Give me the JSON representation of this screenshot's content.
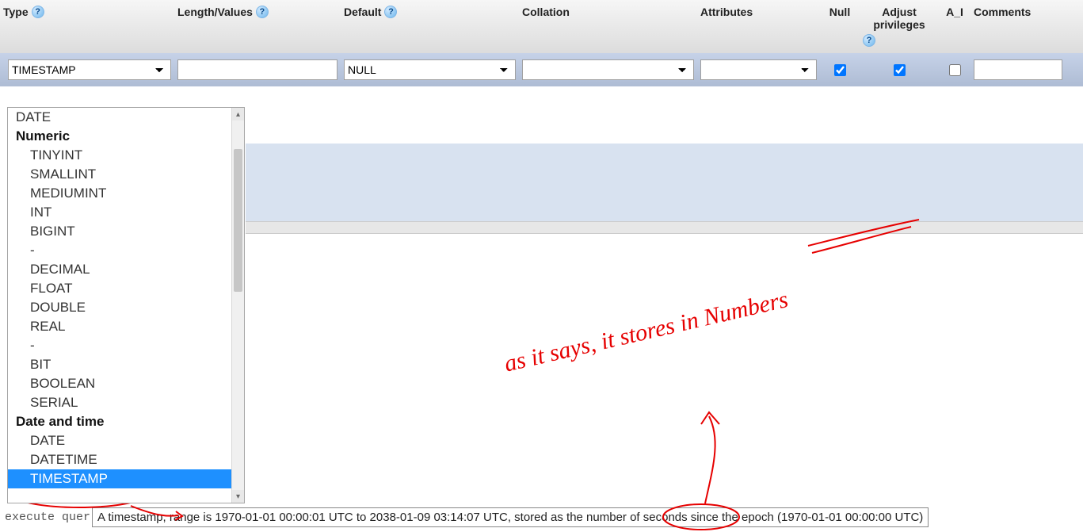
{
  "headers": {
    "type": "Type",
    "length": "Length/Values",
    "default": "Default",
    "collation": "Collation",
    "attributes": "Attributes",
    "null": "Null",
    "adjust": "Adjust privileges",
    "ai": "A_I",
    "comments": "Comments"
  },
  "row": {
    "type_selected": "TIMESTAMP",
    "length_value": "",
    "default_selected": "NULL",
    "collation_selected": "",
    "attributes_selected": "",
    "null_checked": true,
    "adjust_checked": true,
    "ai_checked": false,
    "comments_value": ""
  },
  "type_dropdown": {
    "top_item": "DATE",
    "group_numeric": "Numeric",
    "numeric_items": [
      "TINYINT",
      "SMALLINT",
      "MEDIUMINT",
      "INT",
      "BIGINT"
    ],
    "dash": "-",
    "numeric_items2": [
      "DECIMAL",
      "FLOAT",
      "DOUBLE",
      "REAL"
    ],
    "numeric_items3": [
      "BIT",
      "BOOLEAN",
      "SERIAL"
    ],
    "group_datetime": "Date and time",
    "datetime_items": [
      "DATE",
      "DATETIME",
      "TIMESTAMP"
    ]
  },
  "bottom": {
    "execute_partial": "execute quer",
    "tooltip": "A timestamp, range is 1970-01-01 00:00:01 UTC to 2038-01-09 03:14:07 UTC, stored as the number of seconds since the epoch (1970-01-01 00:00:00 UTC)"
  },
  "annotation": {
    "text": "as it says, it stores in Numbers"
  }
}
